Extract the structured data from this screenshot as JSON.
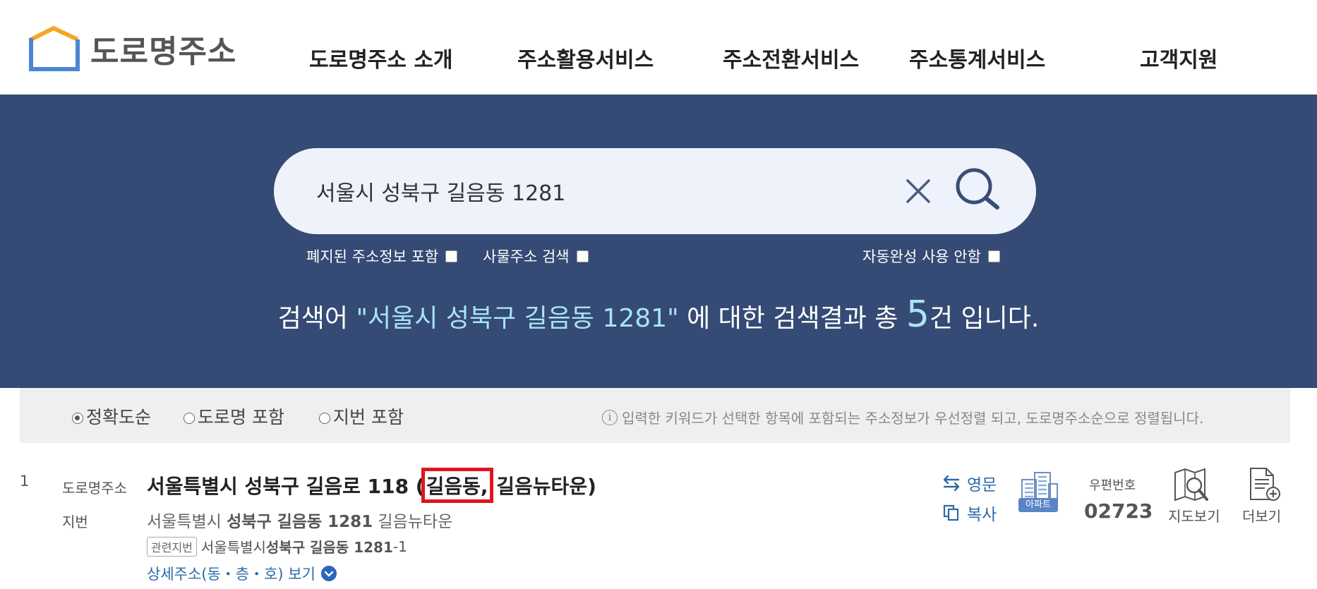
{
  "brand": {
    "name": "도로명주소"
  },
  "nav": [
    {
      "label": "도로명주소 소개"
    },
    {
      "label": "주소활용서비스"
    },
    {
      "label": "주소전환서비스"
    },
    {
      "label": "주소통계서비스"
    },
    {
      "label": "고객지원"
    }
  ],
  "search": {
    "value": "서울시 성북구 길음동 1281",
    "options": {
      "abolished": "폐지된 주소정보 포함",
      "object": "사물주소 검색",
      "autocomplete_off": "자동완성 사용 안함"
    },
    "result": {
      "prefix": "검색어 ",
      "keyword": "\"서울시 성북구 길음동 1281\"",
      "middle": " 에 대한 검색결과 총 ",
      "count": "5",
      "suffix": "건 입니다."
    }
  },
  "sort": {
    "options": [
      {
        "label": "정확도순",
        "selected": true
      },
      {
        "label": "도로명 포함",
        "selected": false
      },
      {
        "label": "지번 포함",
        "selected": false
      }
    ],
    "info_icon": "i",
    "info": "입력한 키워드가 선택한 항목에 포함되는 주소정보가 우선정렬 되고, 도로명주소순으로 정렬됩니다."
  },
  "results": [
    {
      "index": "1",
      "road_label": "도로명주소",
      "road_main": "서울특별시 성북구 길음로 118 (",
      "road_highlight": "길음동,",
      "road_tail": " 길음뉴타운)",
      "jibun_label": "지번",
      "jibun_city": "서울특별시 ",
      "jibun_bold": "성북구 길음동 1281",
      "jibun_tail": " 길음뉴타운",
      "related_tag": "관련지번",
      "related_city": "서울특별시 ",
      "related_bold": "성북구 길음동 1281",
      "related_tail": "-1",
      "detail_link": "상세주소(동・층・호) 보기",
      "english_label": "영문",
      "copy_label": "복사",
      "building_badge": "아파트",
      "zip_label": "우편번호",
      "zip_code": "02723",
      "map_label": "지도보기",
      "more_label": "더보기"
    }
  ],
  "colors": {
    "banner": "#354a74",
    "search_bg": "#eef2fa",
    "highlight_box": "#e0141e",
    "link": "#2b6aa8",
    "keyword": "#a8e4f5"
  }
}
